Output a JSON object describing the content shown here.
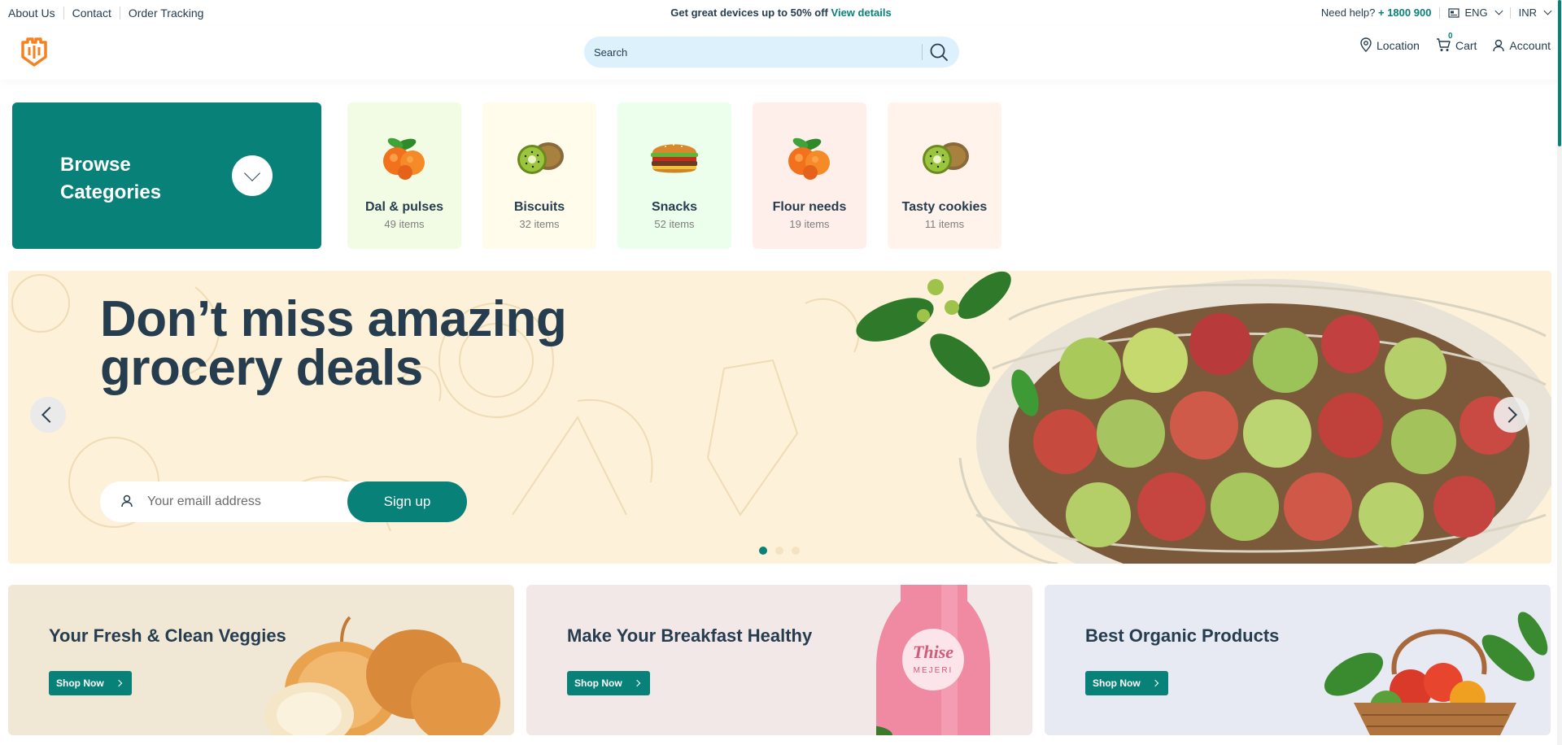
{
  "topbar": {
    "links": [
      "About Us",
      "Contact",
      "Order Tracking"
    ],
    "promo_text": "Get great devices up to 50% off",
    "promo_link": "View details",
    "help_label": "Need help?",
    "help_phone": "+ 1800 900",
    "language": "ENG",
    "currency": "INR"
  },
  "header": {
    "search_placeholder": "Search",
    "location_label": "Location",
    "cart_label": "Cart",
    "cart_count": "0",
    "account_label": "Account"
  },
  "browse": {
    "title": "Browse\nCategories"
  },
  "categories": [
    {
      "name": "Dal & pulses",
      "count": "49 items",
      "bg": "#f2fce4",
      "icon": "orange-icon"
    },
    {
      "name": "Biscuits",
      "count": "32 items",
      "bg": "#fffceb",
      "icon": "kiwi-icon"
    },
    {
      "name": "Snacks",
      "count": "52 items",
      "bg": "#ecffec",
      "icon": "burger-icon"
    },
    {
      "name": "Flour needs",
      "count": "19 items",
      "bg": "#feefea",
      "icon": "orange-icon"
    },
    {
      "name": "Tasty cookies",
      "count": "11 items",
      "bg": "#fff3eb",
      "icon": "kiwi-icon"
    }
  ],
  "hero": {
    "headline": "Don’t miss amazing\ngrocery deals",
    "email_placeholder": "Your emaill address",
    "signup_label": "Sign up",
    "slides": 3,
    "active_slide": 1
  },
  "banners": [
    {
      "title": "Your Fresh & Clean Veggies",
      "cta": "Shop Now",
      "bg": "#f0e8d5"
    },
    {
      "title": "Make Your Breakfast Healthy",
      "cta": "Shop Now",
      "bg": "#f3e8e8"
    },
    {
      "title": "Best Organic Products",
      "cta": "Shop Now",
      "bg": "#e7eaf3"
    }
  ],
  "colors": {
    "brand": "#088178",
    "text": "#253d4e",
    "logo": "#f58220",
    "search_bg": "#dcf1fc"
  }
}
